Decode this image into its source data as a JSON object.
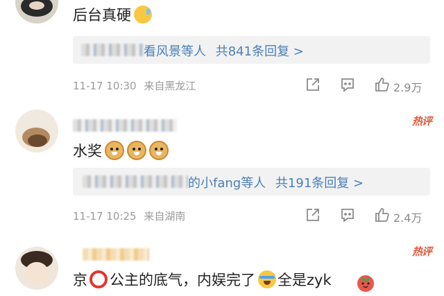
{
  "comments": [
    {
      "text": "后台真硬",
      "reply_summary": {
        "names_suffix": "看风景等人",
        "count_text": "共841条回复 >"
      },
      "date": "11-17 10:30",
      "location": "来自黑龙江",
      "likes": "2.9万",
      "icons": [
        "share-icon",
        "comment-icon",
        "like-icon"
      ]
    },
    {
      "text": "水奖",
      "hot_badge": "热评",
      "reply_summary": {
        "names_suffix": "的小fang等人",
        "count_text": "共191条回复 >"
      },
      "date": "11-17 10:25",
      "location": "来自湖南",
      "likes": "2.4万",
      "icons": [
        "share-icon",
        "comment-icon",
        "like-icon"
      ]
    },
    {
      "text_part1": "京",
      "text_part2": "公主的底气，内娱完了",
      "text_part3": "全是zyk",
      "hot_badge": "热评"
    }
  ],
  "colors": {
    "accent_link": "#4a7fb8",
    "hot_badge": "#e05a3b",
    "meta_gray": "#9a9a9a",
    "reply_bg": "#f2f2f2",
    "ring_red": "#e3352f"
  }
}
